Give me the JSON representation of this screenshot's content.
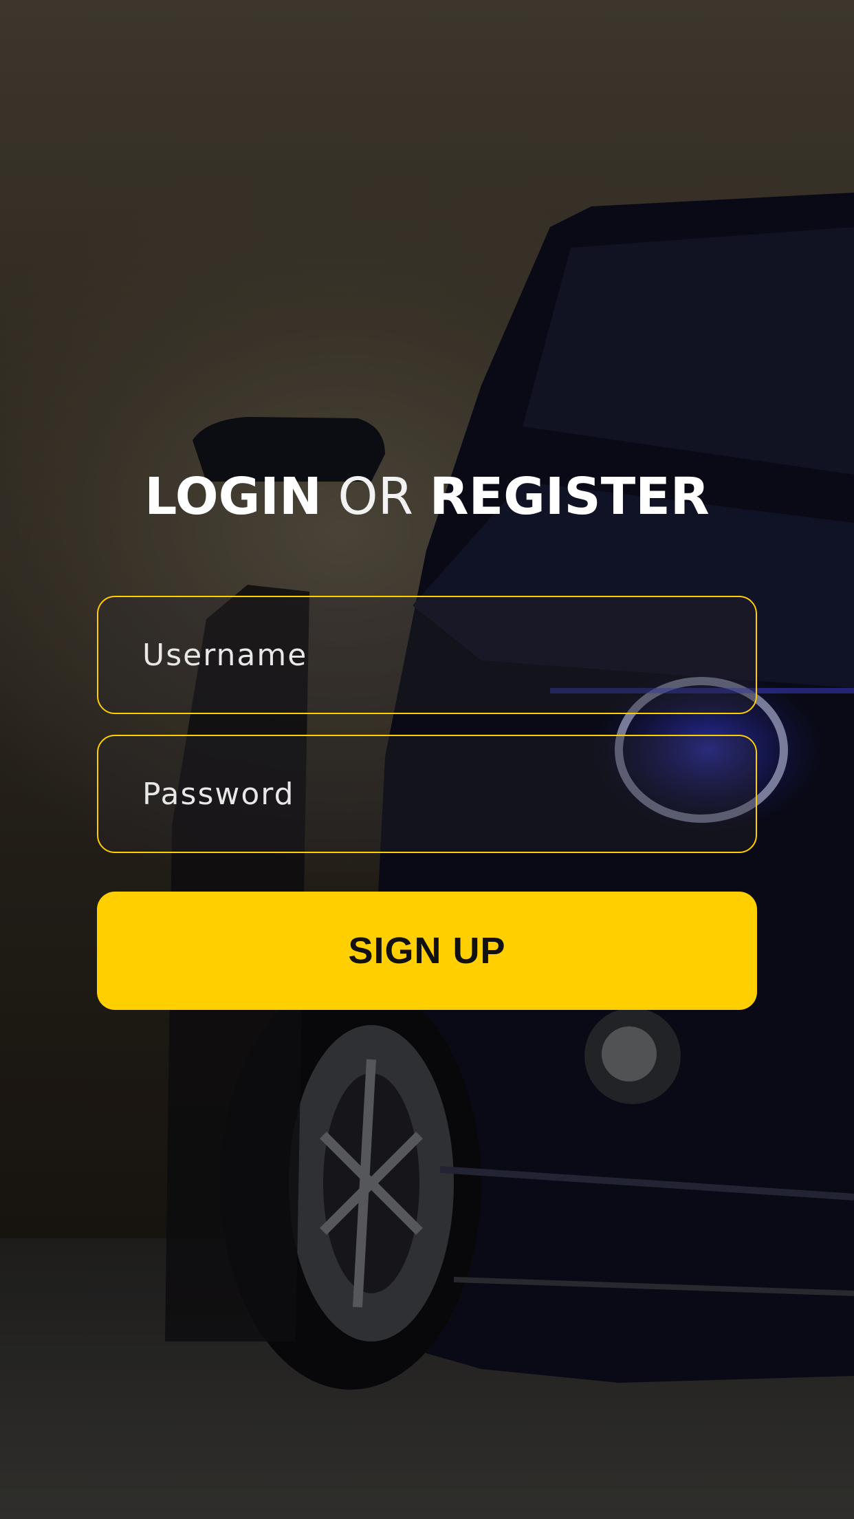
{
  "screen": {
    "background_image": "car-front-photo",
    "accent_color": "#ffcf00"
  },
  "title": {
    "part1": "LOGIN",
    "part2": "OR",
    "part3": "REGISTER"
  },
  "form": {
    "username_placeholder": "Username",
    "username_value": "",
    "password_placeholder": "Password",
    "password_value": "",
    "submit_label": "SIGN UP"
  }
}
